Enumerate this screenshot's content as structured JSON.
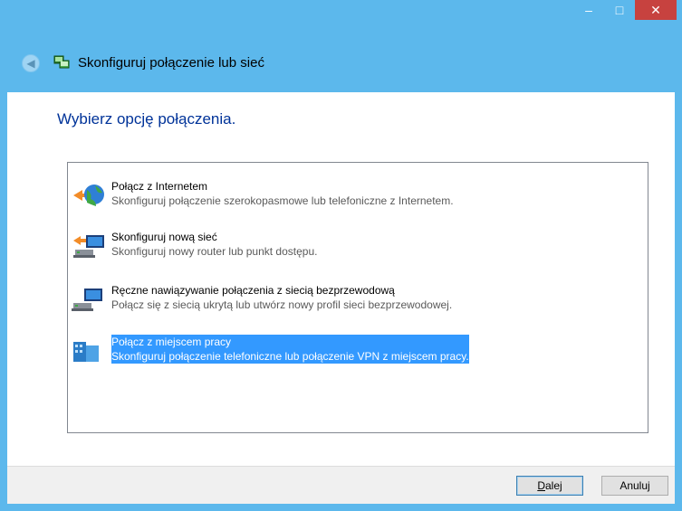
{
  "window": {
    "title": "Skonfiguruj połączenie lub sieć",
    "minimize": "–",
    "maximize": "□",
    "close": "✕",
    "accent_color": "#5cb8ec"
  },
  "main": {
    "instruction": "Wybierz opcję połączenia."
  },
  "options": [
    {
      "title": "Połącz z Internetem",
      "description": "Skonfiguruj połączenie szerokopasmowe lub telefoniczne z Internetem.",
      "icon": "globe-network-icon"
    },
    {
      "title": "Skonfiguruj nową sieć",
      "description": "Skonfiguruj nowy router lub punkt dostępu.",
      "icon": "router-setup-icon"
    },
    {
      "title": "Ręczne nawiązywanie połączenia z siecią bezprzewodową",
      "description": "Połącz się z siecią ukrytą lub utwórz nowy profil sieci bezprzewodowej.",
      "icon": "wireless-network-icon"
    },
    {
      "title": "Połącz z miejscem pracy",
      "description": "Skonfiguruj połączenie telefoniczne lub połączenie VPN z miejscem pracy.",
      "icon": "workplace-vpn-icon",
      "selected": true
    }
  ],
  "footer": {
    "next_label": "Dalej",
    "next_mnemonic": "D",
    "next_rest": "alej",
    "cancel_label": "Anuluj"
  }
}
